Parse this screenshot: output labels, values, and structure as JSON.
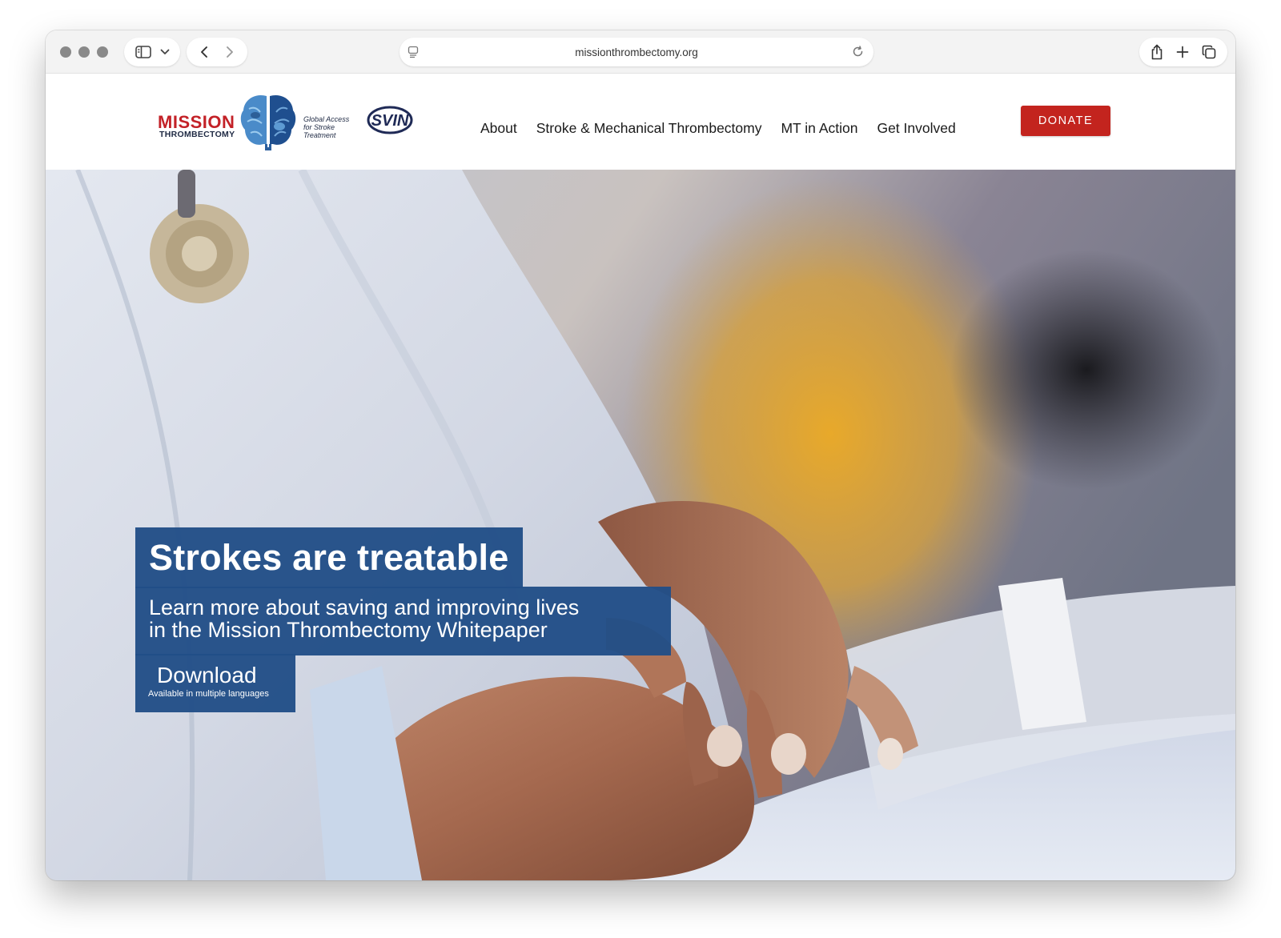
{
  "browser": {
    "url": "missionthrombectomy.org",
    "icons": [
      "sidebar-icon",
      "chevron-down-icon",
      "back-icon",
      "forward-icon",
      "page-icon",
      "reload-icon",
      "share-icon",
      "new-tab-icon",
      "tabs-overview-icon"
    ]
  },
  "logo": {
    "mission": "MISSION",
    "thrombectomy": "THROMBECTOMY",
    "tagline_1": "Global Access",
    "tagline_2": "for Stroke",
    "tagline_3": "Treatment",
    "partner": "SVIN"
  },
  "nav": {
    "items": [
      {
        "label": "About"
      },
      {
        "label": "Stroke & Mechanical Thrombectomy"
      },
      {
        "label": "MT in Action"
      },
      {
        "label": "Get Involved"
      }
    ],
    "donate_label": "DONATE"
  },
  "hero": {
    "headline": "Strokes are treatable",
    "subline_1": "Learn more about saving and improving lives",
    "subline_2": "in the Mission Thrombectomy Whitepaper",
    "download_label": "Download",
    "download_note": "Available in multiple languages"
  },
  "colors": {
    "brand_red": "#c3241e",
    "brand_navy": "#214e87",
    "brain_blue": "#3f7fbf"
  }
}
